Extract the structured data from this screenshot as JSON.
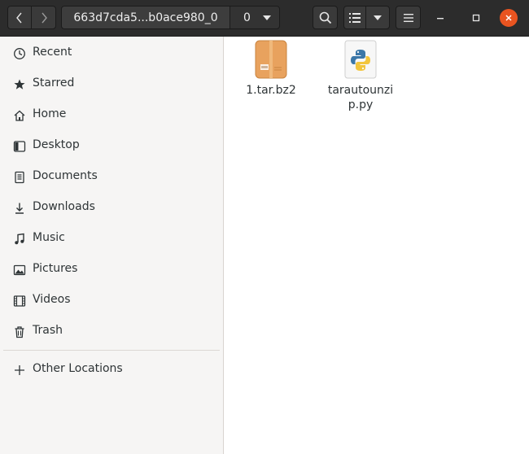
{
  "header": {
    "path_segment": "663d7cda5...b0ace980_0",
    "path_sub": "0",
    "icons": [
      "back-arrow-icon",
      "forward-arrow-icon",
      "search-icon",
      "list-view-icon",
      "dropdown-caret-icon",
      "hamburger-menu-icon",
      "minimize-icon",
      "maximize-icon",
      "close-icon"
    ]
  },
  "sidebar": {
    "items": [
      {
        "label": "Recent",
        "icon": "clock-icon"
      },
      {
        "label": "Starred",
        "icon": "star-icon"
      },
      {
        "label": "Home",
        "icon": "home-icon"
      },
      {
        "label": "Desktop",
        "icon": "desktop-icon"
      },
      {
        "label": "Documents",
        "icon": "document-icon"
      },
      {
        "label": "Downloads",
        "icon": "download-icon"
      },
      {
        "label": "Music",
        "icon": "music-note-icon"
      },
      {
        "label": "Pictures",
        "icon": "picture-icon"
      },
      {
        "label": "Videos",
        "icon": "film-icon"
      },
      {
        "label": "Trash",
        "icon": "trash-icon"
      }
    ],
    "other_locations": {
      "label": "Other Locations",
      "icon": "plus-icon"
    }
  },
  "files": [
    {
      "name": "1.tar.bz2",
      "icon": "archive-icon"
    },
    {
      "name": "tarautounzip.py",
      "icon": "python-icon"
    }
  ],
  "colors": {
    "headerbar": "#2c2c2c",
    "close_button": "#e95420",
    "sidebar_bg": "#f6f5f4",
    "archive": "#e8a25e"
  }
}
